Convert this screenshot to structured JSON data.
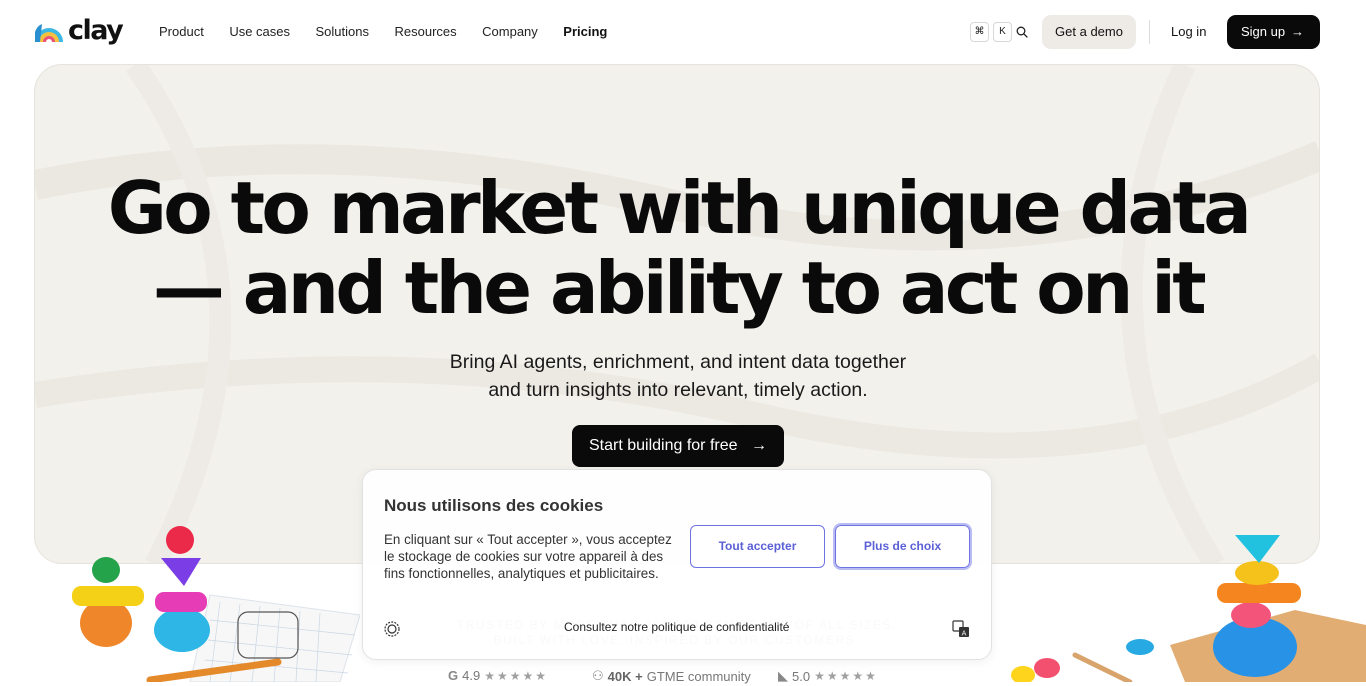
{
  "brand": {
    "name": "clay"
  },
  "nav": {
    "items": [
      {
        "label": "Product"
      },
      {
        "label": "Use cases"
      },
      {
        "label": "Solutions"
      },
      {
        "label": "Resources"
      },
      {
        "label": "Company"
      },
      {
        "label": "Pricing"
      }
    ],
    "shortcut_keys": [
      "⌘",
      "K"
    ],
    "demo_label": "Get a demo",
    "login_label": "Log in",
    "signup_label": "Sign up"
  },
  "hero": {
    "headline_line1": "Go to market with unique data",
    "headline_line2": "— and the ability to act on it",
    "subhead_line1": "Bring AI agents, enrichment, and intent data together",
    "subhead_line2": "and turn insights into relevant, timely action.",
    "cta_label": "Start building for free"
  },
  "trusted": {
    "line1": "TRUSTED BY MORE THAN 300,000 GTM TEAMS OF ALL SIZES.",
    "line2": "BUILT WITH LOVE. INSPIRED BY OUR CUSTOMERS."
  },
  "ratings": [
    {
      "value": "4.9",
      "stars": "★★★★★",
      "icon": "g2-icon"
    },
    {
      "value": "40K +",
      "text": "GTME community",
      "icon": "community-icon"
    },
    {
      "value": "5.0",
      "stars": "★★★★★",
      "icon": "capterra-icon"
    }
  ],
  "cookie": {
    "title": "Nous utilisons des cookies",
    "body": "En cliquant sur « Tout accepter », vous acceptez le stockage de cookies sur votre appareil à des fins fonctionnelles, analytiques et publicitaires.",
    "accept_label": "Tout accepter",
    "more_label": "Plus de choix",
    "policy_label": "Consultez notre politique de confidentialité"
  },
  "colors": {
    "accent_cookie": "#5b60d6",
    "cta_bg": "#0a0a0a",
    "hero_bg": "#f3f1ec"
  }
}
